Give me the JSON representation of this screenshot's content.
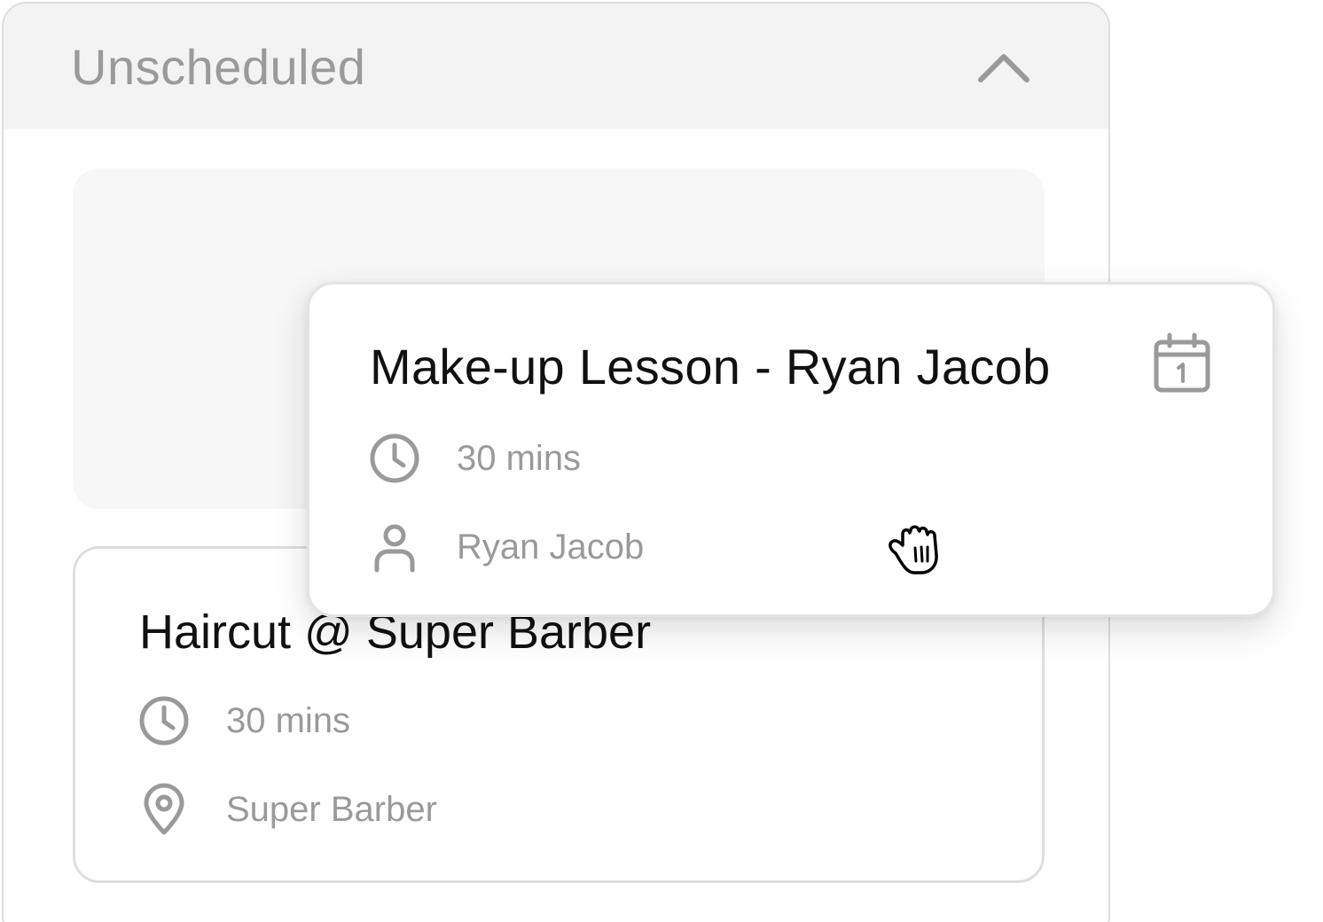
{
  "panel": {
    "title": "Unscheduled",
    "collapse_icon": "chevron-up-icon"
  },
  "haircut_card": {
    "title": "Haircut @ Super Barber",
    "duration": "30 mins",
    "duration_icon": "clock-icon",
    "location": "Super Barber",
    "location_icon": "location-pin-icon"
  },
  "dragged_card": {
    "title": "Make-up Lesson - Ryan Jacob",
    "duration": "30 mins",
    "duration_icon": "clock-icon",
    "person": "Ryan Jacob",
    "person_icon": "person-icon",
    "schedule_icon": "calendar-icon"
  },
  "cursor": {
    "type": "grab-hand-cursor-icon"
  },
  "colors": {
    "header_bg": "#f3f3f3",
    "muted_text": "#9a9a9a",
    "title_text": "#111111",
    "border": "#dedede",
    "slot_bg": "#f7f7f7"
  }
}
